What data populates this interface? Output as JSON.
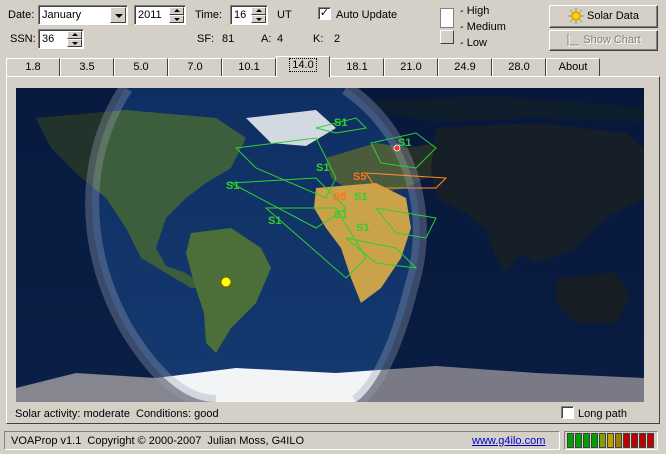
{
  "controls": {
    "date_label": "Date:",
    "month": "January",
    "year": "2011",
    "time_label": "Time:",
    "hour": "16",
    "ut_label": "UT",
    "auto_update_label": "Auto Update",
    "auto_update_checked": true,
    "ssn_label": "SSN:",
    "ssn": "36",
    "sf_label": "SF:",
    "sf": "81",
    "a_label": "A:",
    "a": "4",
    "k_label": "K:",
    "k": "2"
  },
  "legend": {
    "high": "High",
    "medium": "Medium",
    "low": "Low"
  },
  "buttons": {
    "solar_data": "Solar Data",
    "show_chart": "Show Chart"
  },
  "tabs": [
    {
      "label": "1.8",
      "active": false
    },
    {
      "label": "3.5",
      "active": false
    },
    {
      "label": "5.0",
      "active": false
    },
    {
      "label": "7.0",
      "active": false
    },
    {
      "label": "10.1",
      "active": false
    },
    {
      "label": "14.0",
      "active": true
    },
    {
      "label": "18.1",
      "active": false
    },
    {
      "label": "21.0",
      "active": false
    },
    {
      "label": "24.9",
      "active": false
    },
    {
      "label": "28.0",
      "active": false
    },
    {
      "label": "About",
      "active": false
    }
  ],
  "map": {
    "signal_labels": [
      "S1",
      "S1",
      "S5",
      "S5",
      "S1",
      "S1",
      "S1",
      "S1",
      "S1",
      "S1"
    ],
    "colors": {
      "ocean": "#1c3f74",
      "land": "#4f6a3a",
      "coverage": "#2ed12e",
      "sun": "#ffff00",
      "station": "#ff3030"
    }
  },
  "bottom": {
    "solar_activity": "Solar activity: moderate",
    "conditions": "Conditions: good",
    "long_path_label": "Long path",
    "long_path_checked": false
  },
  "status": {
    "text": "VOAProp v1.1  Copyright © 2000-2007  Julian Moss, G4ILO",
    "link": "www.g4ilo.com"
  },
  "meter_colors": [
    "#00a000",
    "#00a000",
    "#00a000",
    "#00a000",
    "#80a000",
    "#c0a000",
    "#a08000",
    "#c00000",
    "#c00000",
    "#c00000",
    "#c00000"
  ]
}
